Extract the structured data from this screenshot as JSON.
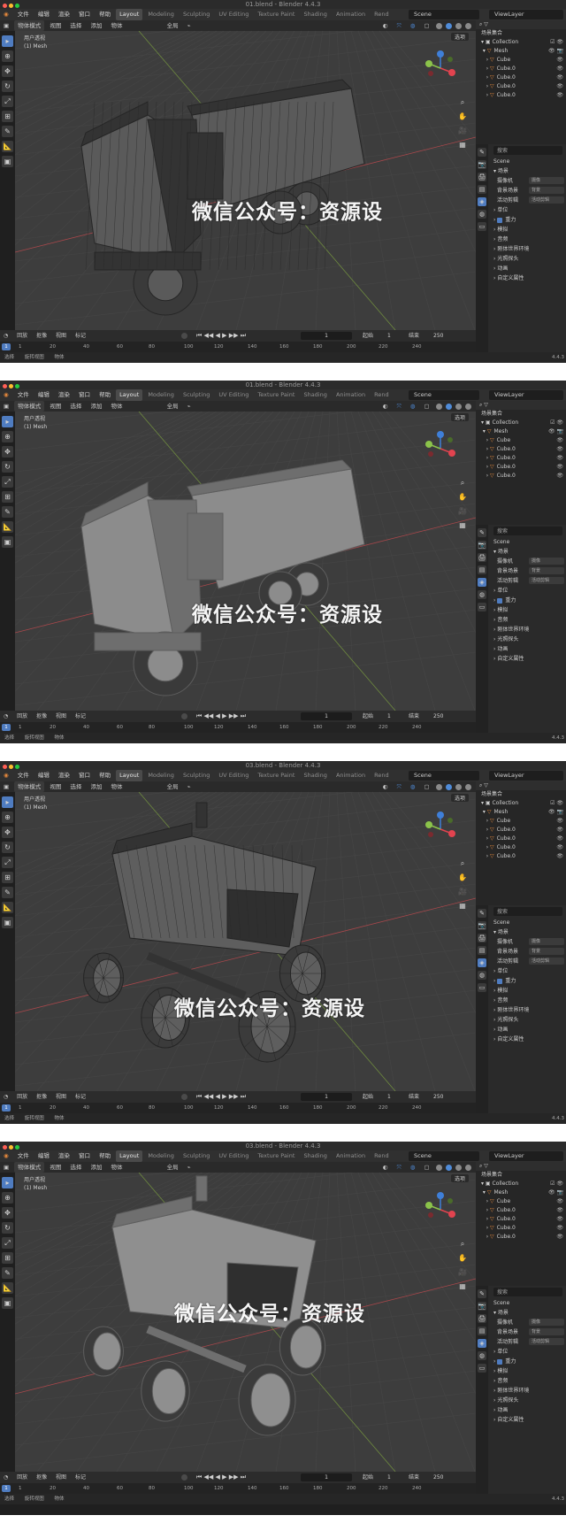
{
  "screens": [
    {
      "window_title": "01.blend - Blender 4.4.3",
      "model": "truck-wire",
      "watermark": "微信公众号：资源设"
    },
    {
      "window_title": "01.blend - Blender 4.4.3",
      "model": "truck-solid",
      "watermark": "微信公众号：资源设"
    },
    {
      "window_title": "03.blend - Blender 4.4.3",
      "model": "rover-wire",
      "watermark": "微信公众号：资源设"
    },
    {
      "window_title": "03.blend - Blender 4.4.3",
      "model": "rover-solid",
      "watermark": "微信公众号：资源设"
    }
  ],
  "menu": [
    "文件",
    "编辑",
    "渲染",
    "窗口",
    "帮助"
  ],
  "workspaces": [
    "Layout",
    "Modeling",
    "Sculpting",
    "UV Editing",
    "Texture Paint",
    "Shading",
    "Animation",
    "Rend"
  ],
  "active_workspace": "Layout",
  "scene_name": "Scene",
  "view_layer": "ViewLayer",
  "viewport_header": {
    "mode": "物体模式",
    "view": "视图",
    "select": "选择",
    "add": "添加",
    "object": "物体",
    "orient": "全局",
    "options": "选项"
  },
  "viewport_info": {
    "line1": "用户透视",
    "line2": "(1) Mesh"
  },
  "outliner": {
    "title": "场景集合",
    "collection": "Collection",
    "mesh": "Mesh",
    "items": [
      "Cube",
      "Cube.0",
      "Cube.0",
      "Cube.0",
      "Cube.0"
    ]
  },
  "properties": {
    "search": "搜索",
    "scene": "Scene",
    "section_scene": "场景",
    "fields": [
      {
        "label": "摄像机",
        "value": "摄像"
      },
      {
        "label": "背景场景",
        "value": "背景"
      },
      {
        "label": "活动剪辑",
        "value": "活动剪辑"
      }
    ],
    "sections": [
      "单位",
      "重力",
      "模拟",
      "音频",
      "刚体世界环境",
      "光照探头",
      "动画",
      "自定义属性"
    ]
  },
  "timeline": {
    "playback": "回放",
    "keying": "抠像",
    "view": "视图",
    "marker": "标记",
    "current_frame": "1",
    "start_label": "起始",
    "start": "1",
    "end_label": "结束",
    "end": "250"
  },
  "ruler_ticks": [
    "1",
    "20",
    "40",
    "60",
    "80",
    "100",
    "120",
    "140",
    "160",
    "180",
    "200",
    "220",
    "240"
  ],
  "statusbar": {
    "select": "选择",
    "rotate": "旋转视图",
    "object": "物体",
    "version": "4.4.3"
  },
  "colors": {
    "accent": "#4f7cc0",
    "viewport": "#3d3d3d",
    "orange": "#e0863c",
    "x_axis": "#e2434f",
    "y_axis": "#8bc34a",
    "z_axis": "#3f7fd8"
  }
}
